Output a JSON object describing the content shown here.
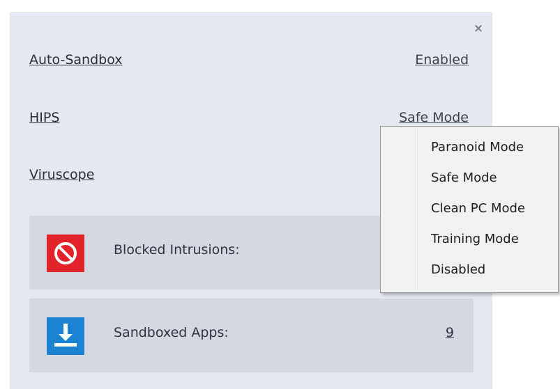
{
  "panel": {
    "close_glyph": "×",
    "rows": [
      {
        "label": "Auto-Sandbox",
        "value": "Enabled"
      },
      {
        "label": "HIPS",
        "value": "Safe Mode"
      },
      {
        "label": "Viruscope",
        "value": ""
      }
    ],
    "stats": [
      {
        "label": "Blocked Intrusions:",
        "value": "",
        "icon": "prohibited-icon",
        "icon_color": "#e2232a"
      },
      {
        "label": "Sandboxed Apps:",
        "value": "9",
        "icon": "download-icon",
        "icon_color": "#1a82d0"
      }
    ]
  },
  "dropdown": {
    "items": [
      "Paranoid Mode",
      "Safe Mode",
      "Clean PC Mode",
      "Training Mode",
      "Disabled"
    ]
  },
  "colors": {
    "panel_bg": "#e5e8f1",
    "stat_bg": "#d4d8e3",
    "blocked_red": "#e2232a",
    "sandbox_blue": "#1a82d0"
  }
}
